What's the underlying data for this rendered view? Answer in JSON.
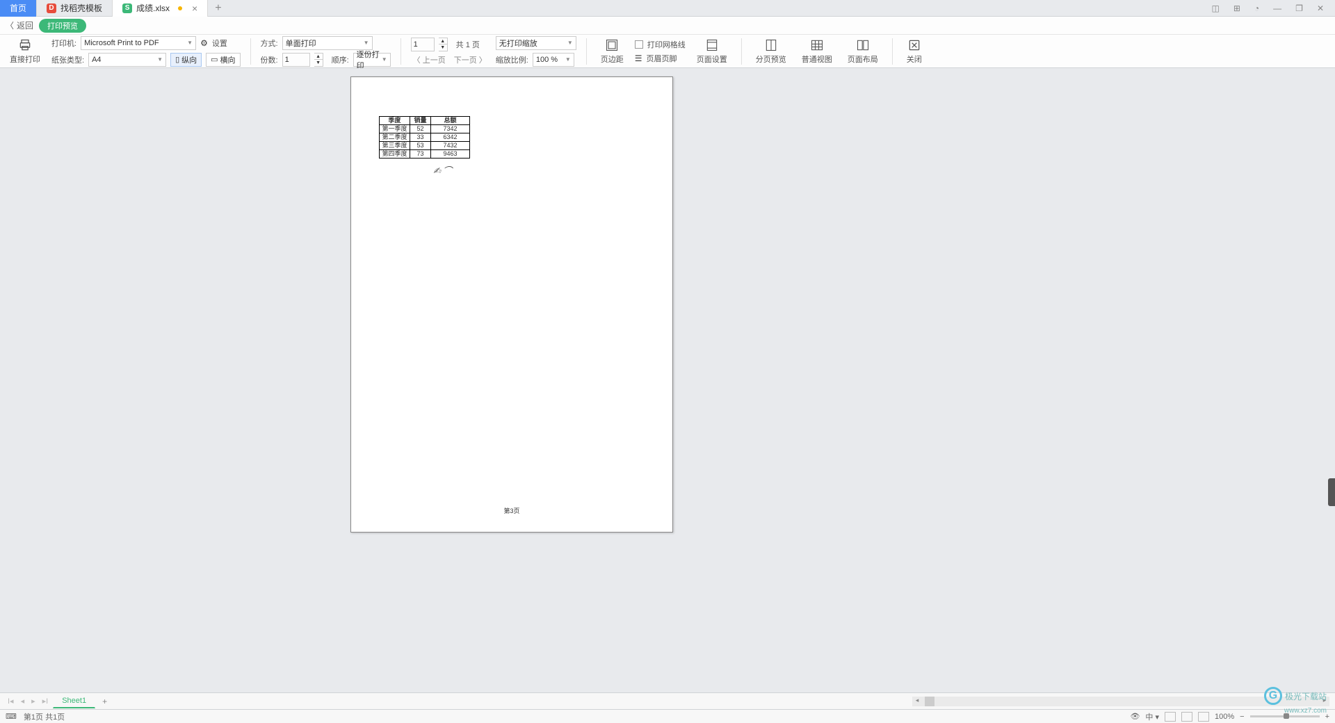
{
  "tabs": {
    "home": "首页",
    "templates": "找稻壳模板",
    "file": "成绩.xlsx"
  },
  "preview_row": {
    "back": "返回",
    "badge": "打印预览"
  },
  "toolbar": {
    "direct_print": "直接打印",
    "printer_label": "打印机:",
    "printer_value": "Microsoft Print to PDF",
    "settings": "设置",
    "paper_type_label": "纸张类型:",
    "paper_type_value": "A4",
    "portrait": "纵向",
    "landscape": "横向",
    "mode_label": "方式:",
    "mode_value": "单面打印",
    "copies_label": "份数:",
    "copies_value": "1",
    "order_label": "顺序:",
    "order_value": "逐份打印",
    "page_input": "1",
    "page_total": "共 1 页",
    "prev_page": "上一页",
    "next_page": "下一页",
    "scale_select": "无打印缩放",
    "zoom_label": "缩放比例:",
    "zoom_value": "100 %",
    "margins": "页边距",
    "gridlines": "打印网格线",
    "header_footer": "页眉页脚",
    "header_footer_icon": "页眉页脚",
    "page_setup": "页面设置",
    "page_break": "分页预览",
    "normal_view": "普通视图",
    "page_layout": "页面布局",
    "close": "关闭"
  },
  "page": {
    "headers": [
      "季度",
      "销量",
      "总额"
    ],
    "rows": [
      [
        "第一季度",
        "52",
        "7342"
      ],
      [
        "第二季度",
        "33",
        "6342"
      ],
      [
        "第三季度",
        "53",
        "7432"
      ],
      [
        "第四季度",
        "73",
        "9463"
      ]
    ],
    "page_number": "第3页",
    "signature": "✍︎ ⌒"
  },
  "sheet_bar": {
    "sheet1": "Sheet1"
  },
  "status": {
    "page_info": "第1页 共1页",
    "zoom": "100%",
    "lang": "中"
  },
  "watermark": {
    "text": "极光下载站",
    "url": "www.xz7.com"
  }
}
